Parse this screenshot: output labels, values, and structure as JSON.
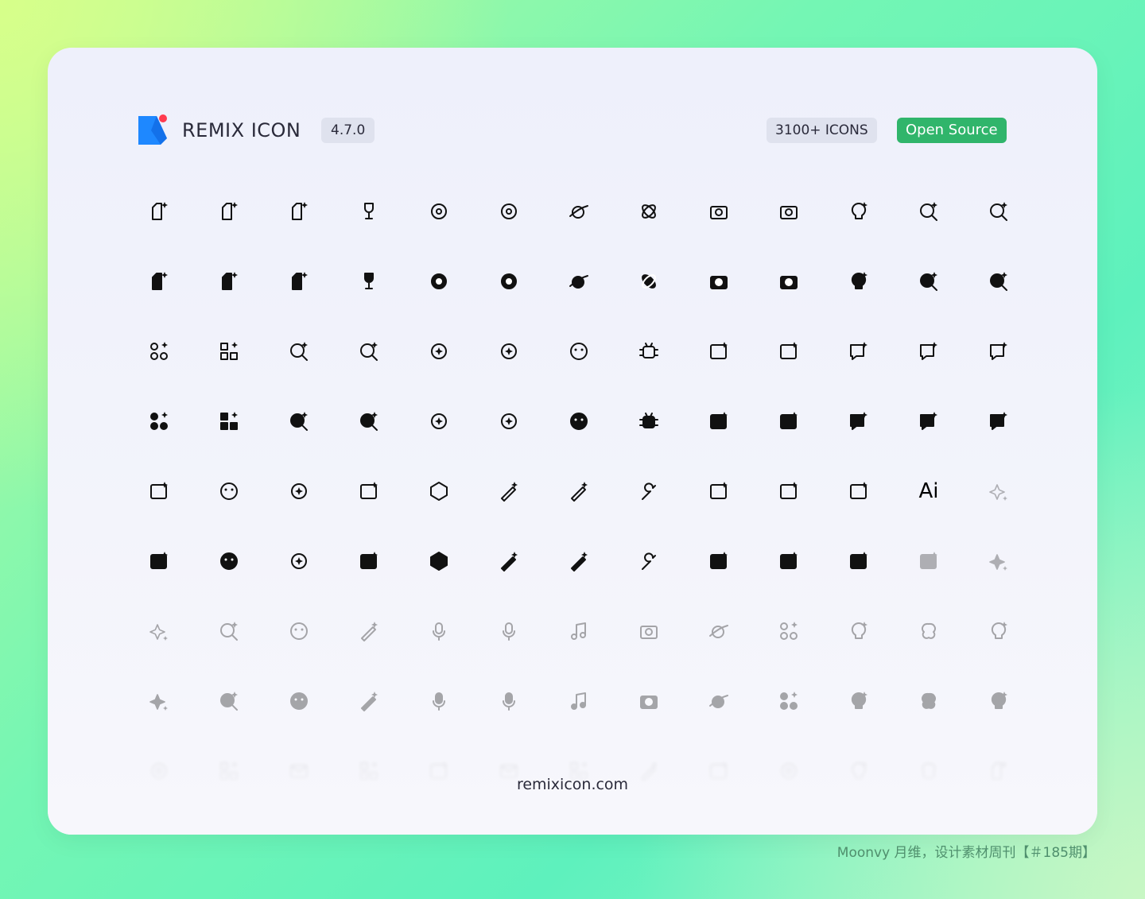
{
  "header": {
    "brand": "REMIX ICON",
    "version": "4.7.0",
    "icon_count": "3100+ ICONS",
    "open_source": "Open Source",
    "colors": {
      "logo_blue": "#1e88ff",
      "logo_red": "#ff3b4f",
      "open_source_bg": "#30b56b"
    }
  },
  "rows": [
    {
      "style": "line",
      "opacity": 1,
      "icons": [
        "file-ai-icon",
        "file-ai-2-icon",
        "book-ai-icon",
        "goblet-icon",
        "flower-icon",
        "flower-star-icon",
        "planet-icon",
        "atom-icon",
        "camera-icon",
        "camera-ai-icon",
        "lightbulb-ai-icon",
        "search-ai-icon",
        "zoom-in-ai-icon"
      ]
    },
    {
      "style": "fill",
      "opacity": 1,
      "icons": [
        "file-ai-icon",
        "file-ai-2-icon",
        "book-ai-icon",
        "goblet-icon",
        "flower-icon",
        "flower-star-icon",
        "planet-icon",
        "atom-icon",
        "camera-icon",
        "camera-ai-icon",
        "lightbulb-ai-icon",
        "search-ai-icon",
        "zoom-in-ai-icon"
      ]
    },
    {
      "style": "line",
      "opacity": 1,
      "icons": [
        "apps-ai-icon",
        "dashboard-ai-icon",
        "refresh-ai-icon",
        "search-ai-2-icon",
        "sync-ai-icon",
        "exchange-ai-icon",
        "emotion-sad-icon",
        "bug-icon",
        "text-ai-icon",
        "translate-ai-icon",
        "chat-ai-icon",
        "chat-ai-2-icon",
        "message-ai-icon"
      ]
    },
    {
      "style": "fill",
      "opacity": 1,
      "icons": [
        "apps-ai-icon",
        "dashboard-ai-icon",
        "refresh-ai-icon",
        "search-ai-2-icon",
        "sync-ai-icon",
        "exchange-ai-icon",
        "emotion-sad-icon",
        "bug-icon",
        "text-ai-icon",
        "translate-ai-icon",
        "chat-ai-icon",
        "chat-ai-2-icon",
        "message-ai-icon"
      ]
    },
    {
      "style": "mixed",
      "opacity": 1,
      "icons": [
        "robot-ai-icon",
        "smile-ai-icon",
        "swirl-icon",
        "square-sparkle-icon",
        "cube-ai-icon",
        "magic-wand-icon",
        "pencil-ai-icon",
        "wrench-icon",
        "cpu-icon",
        "cpu-ai-icon",
        "shop-ai-icon",
        "ai-text-icon",
        "sparkles-icon"
      ],
      "faded_from": 12
    },
    {
      "style": "fill",
      "opacity": 1,
      "icons": [
        "robot-ai-icon",
        "smile-ai-icon",
        "swirl-icon",
        "square-sparkle-icon",
        "cube-ai-icon",
        "magic-wand-icon",
        "pencil-ai-icon",
        "wrench-icon",
        "cpu-icon",
        "cpu-ai-icon",
        "shop-ai-icon",
        "text-box-ai-icon",
        "sparkles-icon"
      ],
      "faded_from": 11
    },
    {
      "style": "line",
      "opacity": 0.35,
      "icons": [
        "sparkle-icon",
        "moon-ai-icon",
        "chat-smile-ai-icon",
        "feather-ai-icon",
        "mic-ai-icon",
        "microphone-ai-icon",
        "music-ai-icon",
        "video-ai-icon",
        "planet-ai-icon",
        "circles-ai-icon",
        "user-voice-ai-icon",
        "brain-icon",
        "robot-face-icon"
      ]
    },
    {
      "style": "fill",
      "opacity": 0.35,
      "icons": [
        "sparkle-icon",
        "moon-ai-icon",
        "chat-smile-ai-icon",
        "feather-ai-icon",
        "mic-ai-icon",
        "microphone-ai-icon",
        "music-ai-icon",
        "video-ai-icon",
        "planet-ai-icon",
        "circles-ai-icon",
        "user-voice-ai-icon",
        "brain-icon",
        "robot-face-icon"
      ]
    },
    {
      "style": "line",
      "opacity": 0.1,
      "icons": [
        "flower-2-icon",
        "image-ai-icon",
        "mail-ai-icon",
        "gallery-ai-icon",
        "square-ai-icon",
        "palette-ai-icon",
        "layout-ai-icon",
        "hand-ai-icon",
        "frame-ai-icon",
        "blob-icon",
        "face-ai-icon",
        "bow-icon",
        "note-ai-icon"
      ]
    }
  ],
  "ai_text_glyph": "Ai",
  "footer": {
    "site": "remixicon.com",
    "credit": "Moonvy 月维，设计素材周刊【＃185期】"
  }
}
